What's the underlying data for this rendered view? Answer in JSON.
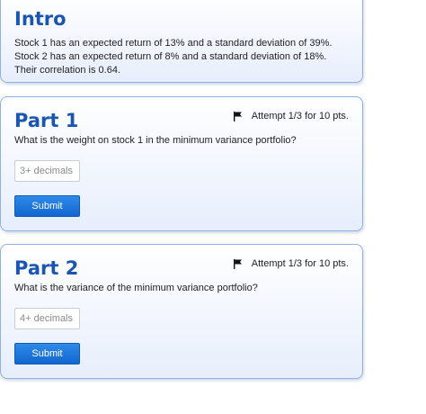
{
  "intro": {
    "title": "Intro",
    "text": "Stock 1 has an expected return of 13% and a standard deviation of 39%. Stock 2 has an expected return of 8% and a standard deviation of 18%. Their correlation is 0.64."
  },
  "parts": [
    {
      "title": "Part 1",
      "attempt": "Attempt 1/3 for 10 pts.",
      "question": "What is the weight on stock 1 in the minimum variance portfolio?",
      "input_placeholder": "3+ decimals",
      "input_value": "",
      "submit_label": "Submit"
    },
    {
      "title": "Part 2",
      "attempt": "Attempt 1/3 for 10 pts.",
      "question": "What is the variance of the minimum variance portfolio?",
      "input_placeholder": "4+ decimals",
      "input_value": "",
      "submit_label": "Submit"
    }
  ],
  "icons": {
    "attempt_flag": "flag-icon"
  },
  "colors": {
    "heading": "#1a56b0",
    "card_border": "#8fb1e6",
    "button": "#1366cf"
  }
}
